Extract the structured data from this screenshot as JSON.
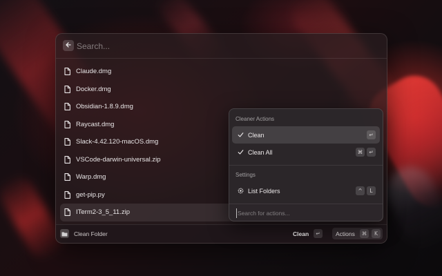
{
  "search": {
    "placeholder": "Search..."
  },
  "files": [
    {
      "label": "Claude.dmg",
      "selected": false
    },
    {
      "label": "Docker.dmg",
      "selected": false
    },
    {
      "label": "Obsidian-1.8.9.dmg",
      "selected": false
    },
    {
      "label": "Raycast.dmg",
      "selected": false
    },
    {
      "label": "Slack-4.42.120-macOS.dmg",
      "selected": false
    },
    {
      "label": "VSCode-darwin-universal.zip",
      "selected": false
    },
    {
      "label": "Warp.dmg",
      "selected": false
    },
    {
      "label": "get-pip.py",
      "selected": false
    },
    {
      "label": "ITerm2-3_5_11.zip",
      "selected": true
    }
  ],
  "footer": {
    "title": "Clean Folder",
    "primary_action": "Clean",
    "primary_shortcut": "↵",
    "actions_label": "Actions",
    "actions_shortcut": [
      "⌘",
      "K"
    ]
  },
  "action_panel": {
    "section1_title": "Cleaner Actions",
    "clean": {
      "label": "Clean",
      "icon": "checkmark-icon",
      "shortcut": [
        "↵"
      ]
    },
    "clean_all": {
      "label": "Clean All",
      "icon": "checkmark-icon",
      "shortcut": [
        "⌘",
        "↵"
      ]
    },
    "section2_title": "Settings",
    "list_folders": {
      "label": "List Folders",
      "icon": "gear-icon",
      "shortcut": [
        "^",
        "L"
      ]
    },
    "search_placeholder": "Search for actions..."
  },
  "colors": {
    "window_bg": "#281c1f",
    "accent_red": "#e0362f"
  }
}
